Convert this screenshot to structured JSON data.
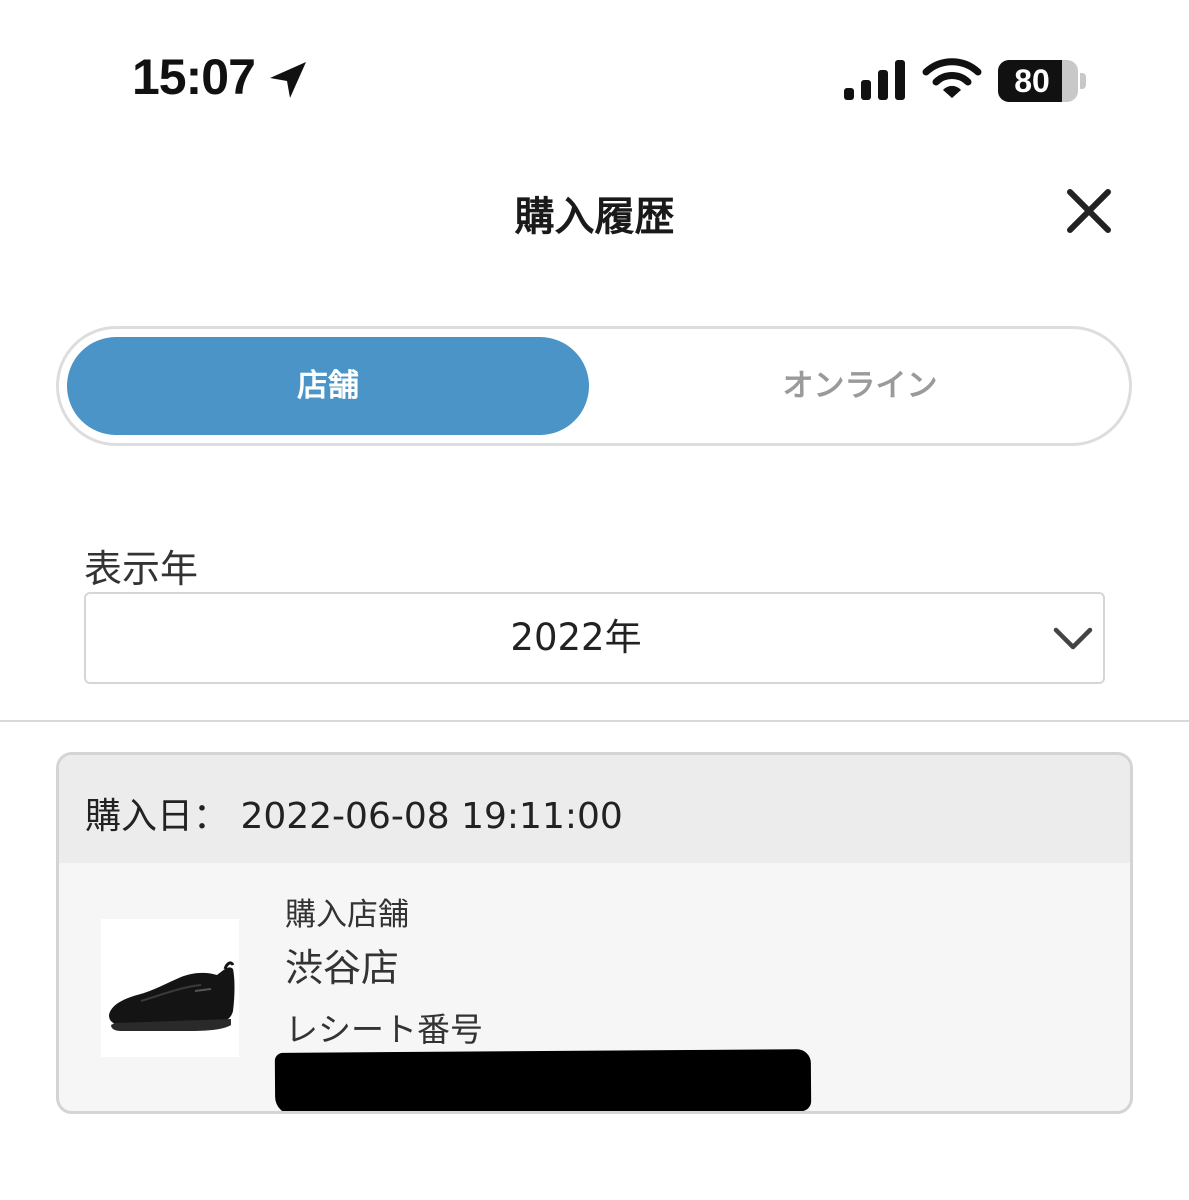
{
  "status_bar": {
    "time": "15:07",
    "battery_level": "80",
    "battery_fraction": 0.8,
    "icons": [
      "location-arrow-icon",
      "cellular-signal-icon",
      "wifi-icon",
      "battery-icon"
    ]
  },
  "header": {
    "title": "購入履歴",
    "close_icon": "close-icon"
  },
  "tabs": [
    {
      "label": "店舗",
      "selected": true
    },
    {
      "label": "オンライン",
      "selected": false
    }
  ],
  "year_filter": {
    "label": "表示年",
    "selected_value": "2022年",
    "icon": "chevron-down-icon"
  },
  "purchases": [
    {
      "date_line": "購入日： 2022-06-08 19:11:00",
      "store_label": "購入店舗",
      "store_name": "渋谷店",
      "receipt_label": "レシート番号",
      "thumbnail": "shoe-thumbnail"
    }
  ],
  "colors": {
    "accent": "#4a94c8",
    "inactive_tab_text": "#9a9a9a",
    "card_header_bg": "#ececec",
    "card_bg": "#f6f6f6"
  }
}
